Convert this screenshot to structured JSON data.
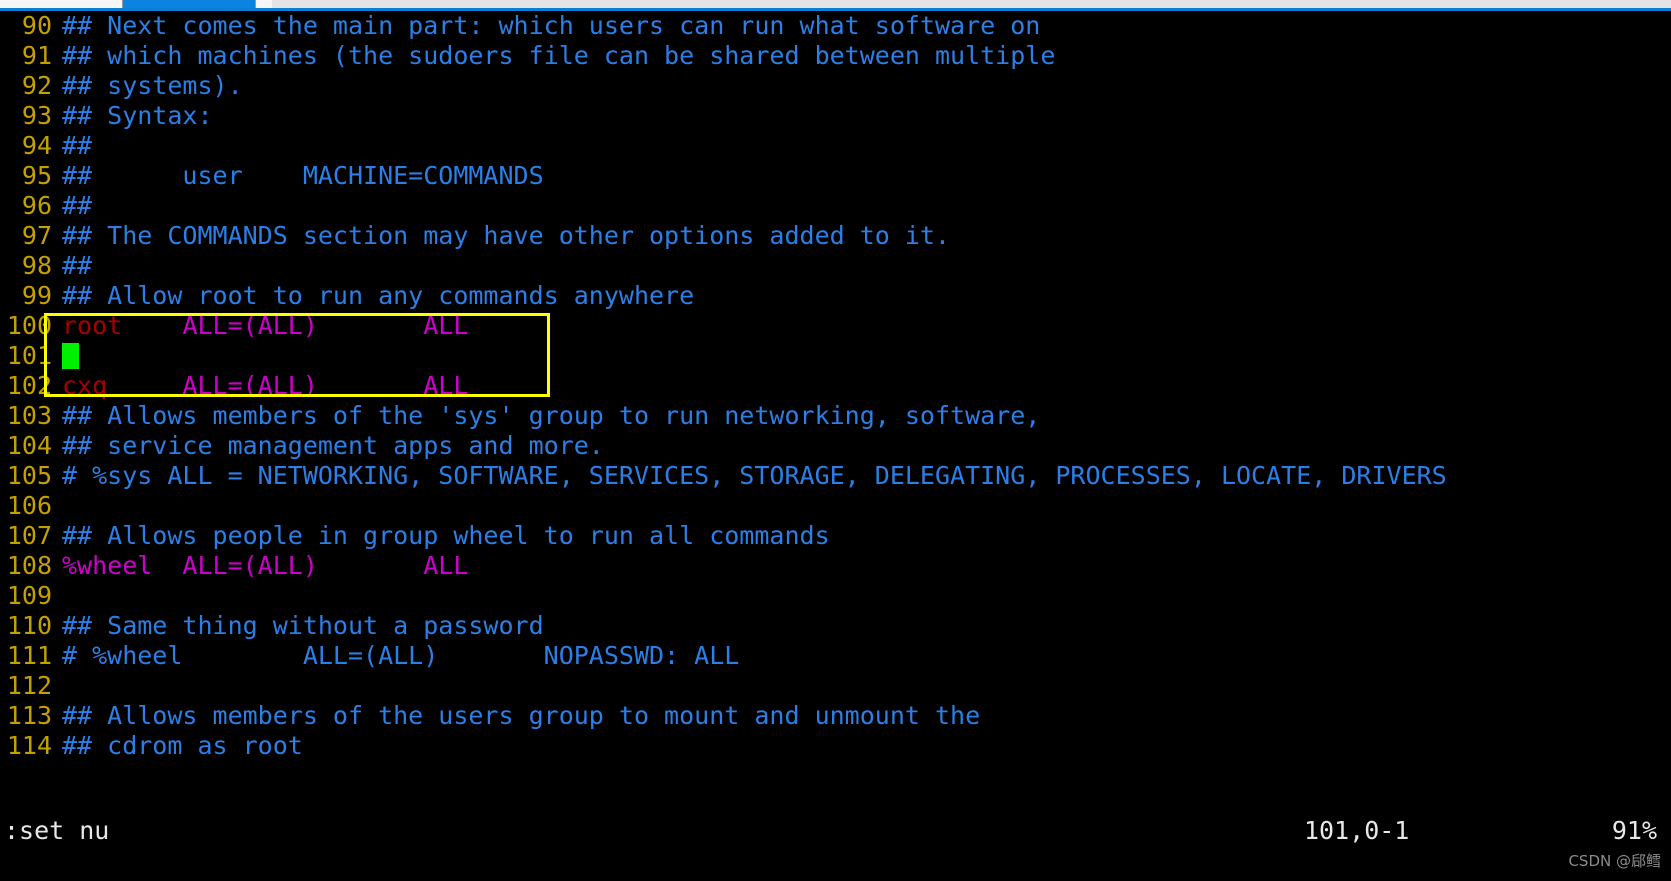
{
  "window": {
    "tabs": [
      {
        "name": "tab-inactive-left",
        "state": "inactive"
      },
      {
        "name": "tab-active",
        "state": "active"
      },
      {
        "name": "tab-inactive-right",
        "state": "inactive"
      }
    ]
  },
  "colors": {
    "background": "#000000",
    "line_number": "#c4a000",
    "comment": "#2b7fe6",
    "user": "#a60000",
    "directive": "#cc00cc",
    "cursor": "#00f000",
    "annotation_box": "#ffff00",
    "status_text": "#e8e8e8",
    "tab_active": "#0a84de"
  },
  "editor": {
    "lines": [
      {
        "num": "90",
        "segments": [
          {
            "class": "c-comment",
            "text": "## Next comes the main part: which users can run what software on"
          }
        ]
      },
      {
        "num": "91",
        "segments": [
          {
            "class": "c-comment",
            "text": "## which machines (the sudoers file can be shared between multiple"
          }
        ]
      },
      {
        "num": "92",
        "segments": [
          {
            "class": "c-comment",
            "text": "## systems)."
          }
        ]
      },
      {
        "num": "93",
        "segments": [
          {
            "class": "c-comment",
            "text": "## Syntax:"
          }
        ]
      },
      {
        "num": "94",
        "segments": [
          {
            "class": "c-comment",
            "text": "##"
          }
        ]
      },
      {
        "num": "95",
        "segments": [
          {
            "class": "c-comment",
            "text": "##      user    MACHINE=COMMANDS"
          }
        ]
      },
      {
        "num": "96",
        "segments": [
          {
            "class": "c-comment",
            "text": "##"
          }
        ]
      },
      {
        "num": "97",
        "segments": [
          {
            "class": "c-comment",
            "text": "## The COMMANDS section may have other options added to it."
          }
        ]
      },
      {
        "num": "98",
        "segments": [
          {
            "class": "c-comment",
            "text": "##"
          }
        ]
      },
      {
        "num": "99",
        "segments": [
          {
            "class": "c-comment",
            "text": "## Allow root to run any commands anywhere"
          }
        ]
      },
      {
        "num": "100",
        "segments": [
          {
            "class": "c-user",
            "text": "root"
          },
          {
            "class": "c-plain",
            "text": "    "
          },
          {
            "class": "c-group",
            "text": "ALL=(ALL)       ALL"
          }
        ]
      },
      {
        "num": "101",
        "segments": [
          {
            "class": "cursor",
            "text": " "
          }
        ]
      },
      {
        "num": "102",
        "segments": [
          {
            "class": "c-user",
            "text": "cxq"
          },
          {
            "class": "c-plain",
            "text": "     "
          },
          {
            "class": "c-group",
            "text": "ALL=(ALL)       ALL"
          }
        ]
      },
      {
        "num": "103",
        "segments": [
          {
            "class": "c-comment",
            "text": "## Allows members of the 'sys' group to run networking, software,"
          }
        ]
      },
      {
        "num": "104",
        "segments": [
          {
            "class": "c-comment",
            "text": "## service management apps and more."
          }
        ]
      },
      {
        "num": "105",
        "segments": [
          {
            "class": "c-comment",
            "text": "# %sys ALL = NETWORKING, SOFTWARE, SERVICES, STORAGE, DELEGATING, PROCESSES, LOCATE, DRIVERS"
          }
        ]
      },
      {
        "num": "106",
        "segments": [
          {
            "class": "c-comment",
            "text": ""
          }
        ]
      },
      {
        "num": "107",
        "segments": [
          {
            "class": "c-comment",
            "text": "## Allows people in group wheel to run all commands"
          }
        ]
      },
      {
        "num": "108",
        "segments": [
          {
            "class": "c-spec",
            "text": "%wheel"
          },
          {
            "class": "c-plain",
            "text": "  "
          },
          {
            "class": "c-group",
            "text": "ALL=(ALL)       ALL"
          }
        ]
      },
      {
        "num": "109",
        "segments": [
          {
            "class": "c-comment",
            "text": ""
          }
        ]
      },
      {
        "num": "110",
        "segments": [
          {
            "class": "c-comment",
            "text": "## Same thing without a password"
          }
        ]
      },
      {
        "num": "111",
        "segments": [
          {
            "class": "c-comment",
            "text": "# %wheel        ALL=(ALL)       NOPASSWD: ALL"
          }
        ]
      },
      {
        "num": "112",
        "segments": [
          {
            "class": "c-comment",
            "text": ""
          }
        ]
      },
      {
        "num": "113",
        "segments": [
          {
            "class": "c-comment",
            "text": "## Allows members of the users group to mount and unmount the"
          }
        ]
      },
      {
        "num": "114",
        "segments": [
          {
            "class": "c-comment",
            "text": "## cdrom as root"
          }
        ]
      }
    ]
  },
  "annotation": {
    "label": "highlight-box-lines-100-102"
  },
  "status": {
    "command": ":set nu",
    "position": "101,0-1",
    "percent": "91%"
  },
  "watermark": {
    "text": "CSDN @郈鳕"
  }
}
